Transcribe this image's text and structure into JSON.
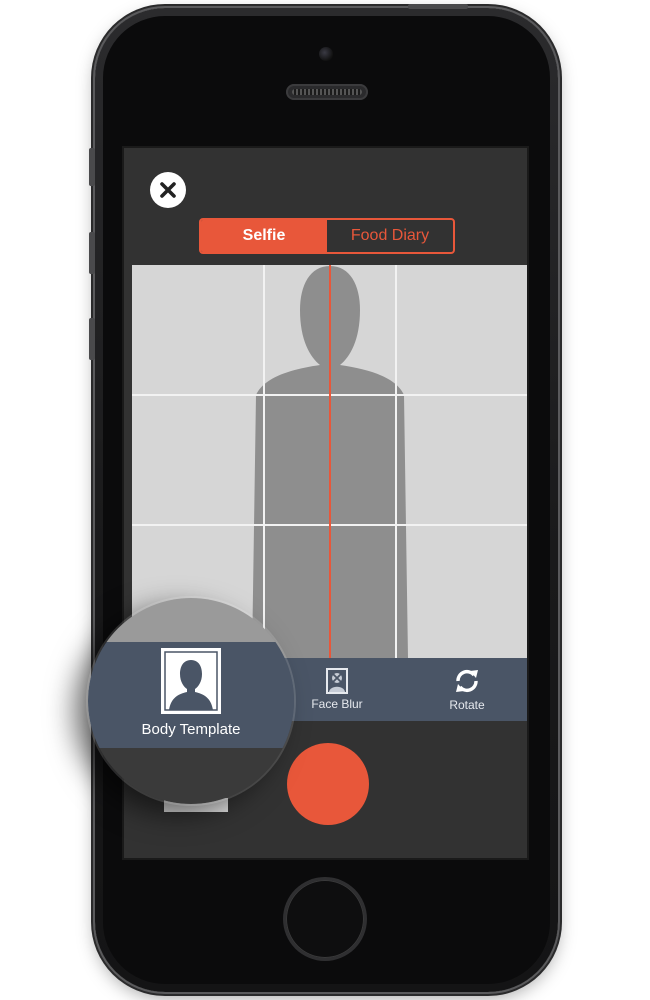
{
  "segmented": {
    "selfie_label": "Selfie",
    "food_diary_label": "Food Diary",
    "active": "Selfie"
  },
  "toolbar": {
    "face_blur_label": "Face Blur",
    "rotate_label": "Rotate"
  },
  "magnifier": {
    "body_template_label": "Body Template"
  },
  "colors": {
    "accent": "#e8573a",
    "screen_bg": "#323232",
    "toolbar_bg": "#4a5566",
    "viewfinder_bg": "#d6d6d6",
    "silhouette": "#8e8e8e"
  },
  "icons": {
    "close": "close-x-icon",
    "face_blur": "face-blur-icon",
    "rotate": "rotate-icon",
    "body_template": "body-silhouette-icon"
  }
}
